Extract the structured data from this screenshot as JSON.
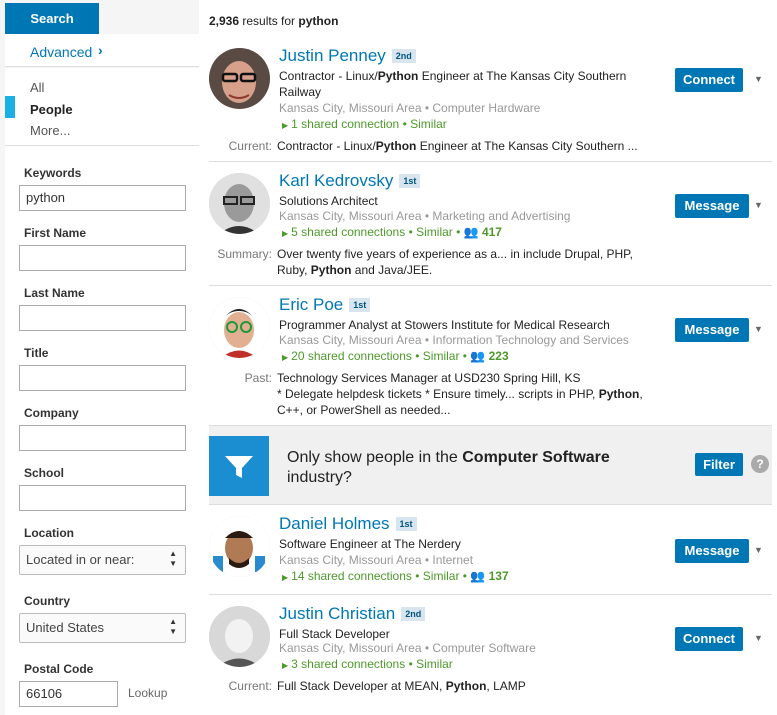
{
  "sidebar": {
    "search_label": "Search",
    "advanced_label": "Advanced",
    "nav": [
      {
        "label": "All"
      },
      {
        "label": "People"
      },
      {
        "label": "More..."
      }
    ],
    "filters": {
      "keywords_label": "Keywords",
      "keywords_value": "python",
      "first_name_label": "First Name",
      "last_name_label": "Last Name",
      "title_label": "Title",
      "company_label": "Company",
      "school_label": "School",
      "location_label": "Location",
      "location_value": "Located in or near:",
      "country_label": "Country",
      "country_value": "United States",
      "postal_code_label": "Postal Code",
      "postal_code_value": "66106",
      "lookup_label": "Lookup"
    }
  },
  "results": {
    "count": "2,936",
    "count_suffix": "results for",
    "query": "python"
  },
  "people": [
    {
      "name": "Justin Penney",
      "degree": "2nd",
      "headline": [
        "Contractor - Linux/",
        "Python",
        " Engineer at The Kansas City Southern Railway"
      ],
      "location": "Kansas City, Missouri Area",
      "industry": "Computer Hardware",
      "shared": "1 shared connection",
      "similar": "Similar",
      "group_count": "",
      "snippet_label": "Current:",
      "snippet": [
        "Contractor - Linux/",
        "Python",
        " Engineer at The Kansas City Southern ..."
      ],
      "action": "Connect"
    },
    {
      "name": "Karl Kedrovsky",
      "degree": "1st",
      "headline": [
        "Solutions Architect"
      ],
      "location": "Kansas City, Missouri Area",
      "industry": "Marketing and Advertising",
      "shared": "5 shared connections",
      "similar": "Similar",
      "group_count": "417",
      "snippet_label": "Summary:",
      "snippet": [
        "Over twenty five years of experience as a... in include Drupal, PHP, Ruby, ",
        "Python",
        " and Java/JEE."
      ],
      "action": "Message"
    },
    {
      "name": "Eric Poe",
      "degree": "1st",
      "headline": [
        "Programmer Analyst at Stowers Institute for Medical Research"
      ],
      "location": "Kansas City, Missouri Area",
      "industry": "Information Technology and Services",
      "shared": "20 shared connections",
      "similar": "Similar",
      "group_count": "223",
      "snippet_label": "Past:",
      "snippet": [
        "Technology Services Manager at USD230 Spring Hill, KS\n* Delegate helpdesk tickets * Ensure timely... scripts in PHP, ",
        "Python",
        ", C++, or PowerShell as needed..."
      ],
      "action": "Message"
    },
    {
      "name": "Daniel Holmes",
      "degree": "1st",
      "headline": [
        "Software Engineer at The Nerdery"
      ],
      "location": "Kansas City, Missouri Area",
      "industry": "Internet",
      "shared": "14 shared connections",
      "similar": "Similar",
      "group_count": "137",
      "snippet_label": "",
      "snippet": [],
      "action": "Message"
    },
    {
      "name": "Justin Christian",
      "degree": "2nd",
      "headline": [
        "Full Stack Developer"
      ],
      "location": "Kansas City, Missouri Area",
      "industry": "Computer Software",
      "shared": "3 shared connections",
      "similar": "Similar",
      "group_count": "",
      "snippet_label": "Current:",
      "snippet": [
        "Full Stack Developer at MEAN, ",
        "Python",
        ", LAMP"
      ],
      "action": "Connect"
    }
  ],
  "filter_banner": {
    "text_pre": "Only show people in the",
    "text_bold": "Computer Software",
    "text_post": "industry?",
    "button_label": "Filter",
    "help_label": "?"
  },
  "colors": {
    "brand": "#0077b5",
    "accent": "#1ab0e6",
    "shared_green": "#4c9a2a"
  }
}
